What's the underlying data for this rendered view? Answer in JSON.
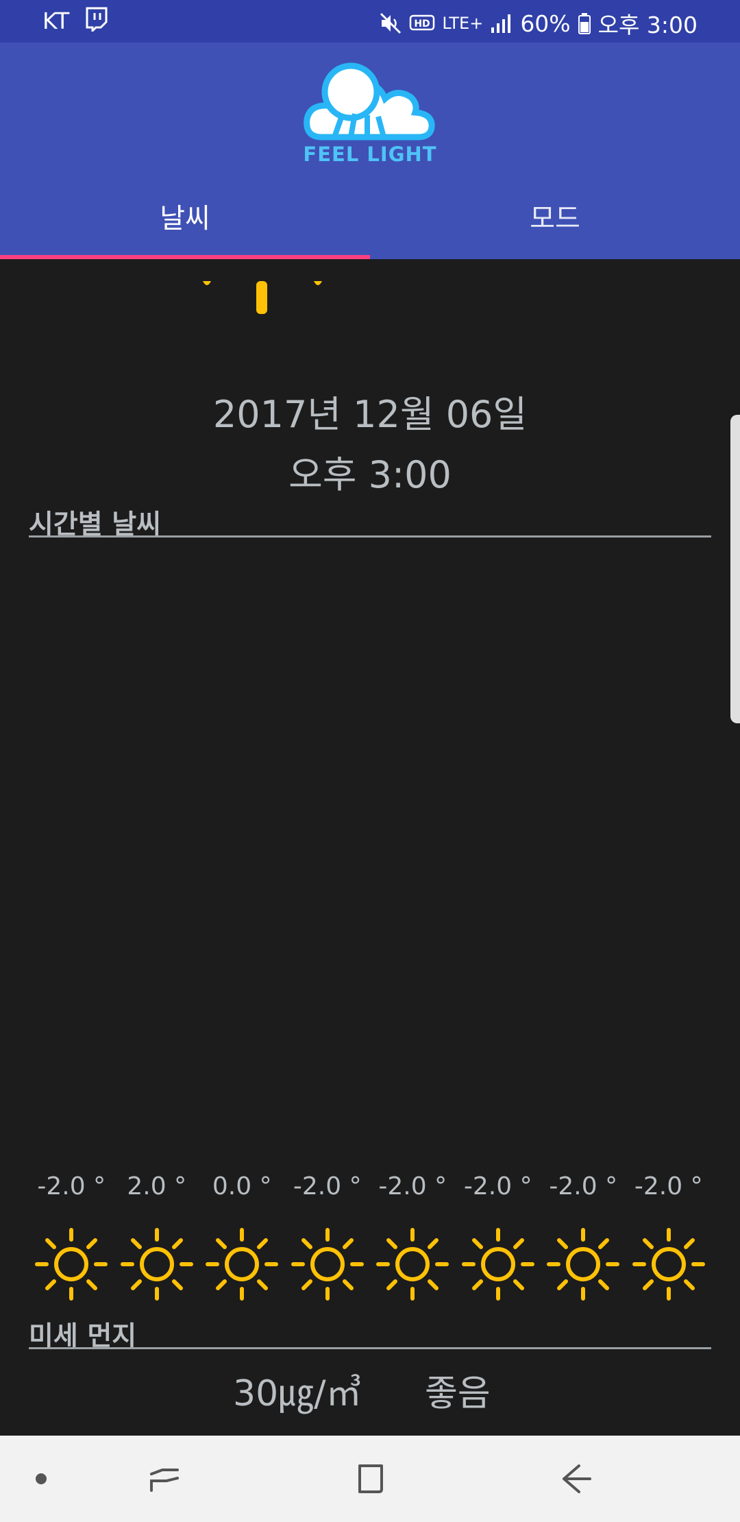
{
  "status_bar": {
    "carrier": "KT",
    "battery": "60%",
    "time": "오후 3:00",
    "network": "LTE+",
    "icons": [
      "twitch-icon",
      "mute-icon",
      "hd-icon",
      "lte-icon",
      "signal-icon",
      "battery-icon"
    ]
  },
  "app": {
    "logo_text": "FEEL LIGHT"
  },
  "tabs": [
    {
      "label": "날씨",
      "selected": true
    },
    {
      "label": "모드",
      "selected": false
    }
  ],
  "weather": {
    "date": "2017년 12월 06일",
    "time": "오후 3:00",
    "hourly_title": "시간별 날씨",
    "hourly": [
      {
        "temp": "-2.0 °",
        "icon": "sun-icon"
      },
      {
        "temp": "2.0 °",
        "icon": "sun-icon"
      },
      {
        "temp": "0.0 °",
        "icon": "sun-icon"
      },
      {
        "temp": "-2.0 °",
        "icon": "sun-icon"
      },
      {
        "temp": "-2.0 °",
        "icon": "sun-icon"
      },
      {
        "temp": "-2.0 °",
        "icon": "sun-icon"
      },
      {
        "temp": "-2.0 °",
        "icon": "sun-icon"
      },
      {
        "temp": "-2.0 °",
        "icon": "sun-icon"
      }
    ]
  },
  "dust": {
    "title": "미세 먼지",
    "value": "30㎍/㎥",
    "grade": "좋음"
  },
  "colors": {
    "status_bar": "#3040a8",
    "app_bar": "#3f51b5",
    "tab_indicator": "#ff4081",
    "background": "#1c1c1c",
    "sun": "#ffc107",
    "text": "#b9bec2"
  }
}
